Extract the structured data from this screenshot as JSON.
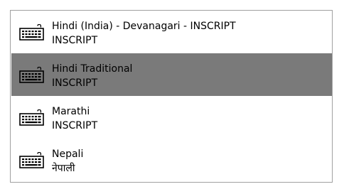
{
  "list": {
    "items": [
      {
        "title": "Hindi (India) - Devanagari - INSCRIPT",
        "subtitle": "INSCRIPT",
        "icon": "keyboard-icon",
        "selected": false
      },
      {
        "title": "Hindi Traditional",
        "subtitle": "INSCRIPT",
        "icon": "keyboard-icon",
        "selected": true
      },
      {
        "title": "Marathi",
        "subtitle": "INSCRIPT",
        "icon": "keyboard-icon",
        "selected": false
      },
      {
        "title": "Nepali",
        "subtitle": "नेपाली",
        "icon": "keyboard-icon",
        "selected": false
      }
    ],
    "colors": {
      "selected_background": "#7a7a7a",
      "border": "#a0a0a0",
      "text": "#000000"
    }
  }
}
